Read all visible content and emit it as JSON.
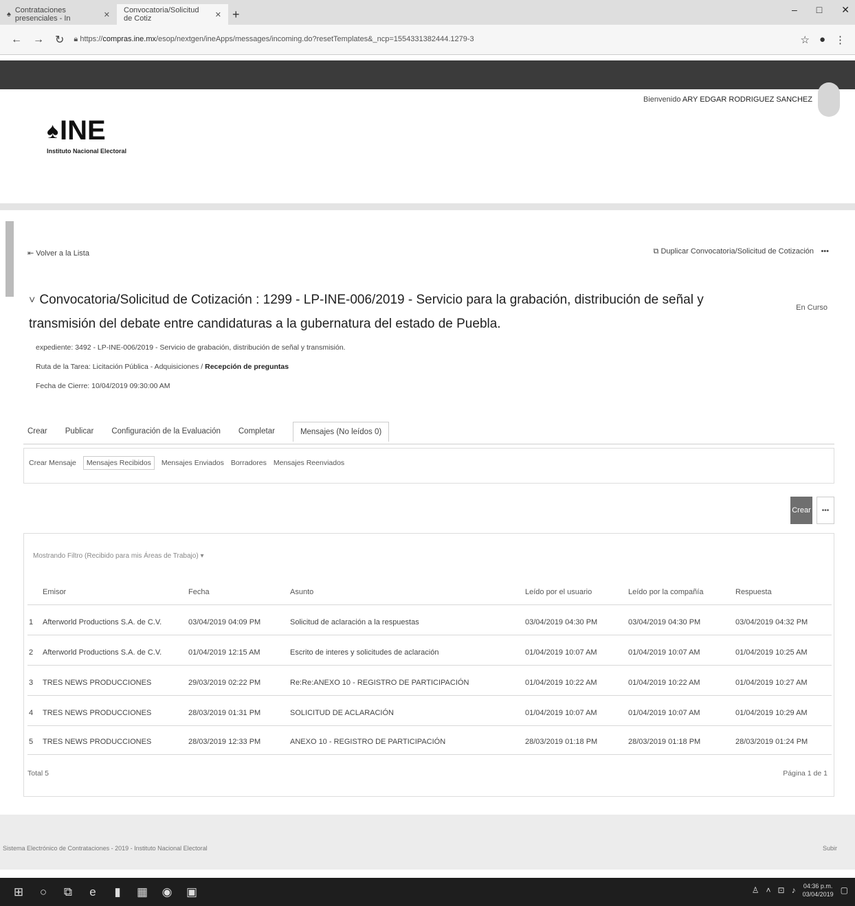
{
  "browser": {
    "tabs": [
      {
        "label": "Contrataciones presenciales - In"
      },
      {
        "label": "Convocatoria/Solicitud de Cotiz"
      }
    ],
    "new_tab": "+",
    "url_prefix": "https://",
    "url_host": "compras.ine.mx",
    "url_path": "/esop/nextgen/ineApps/messages/incoming.do?resetTemplates&_ncp=1554331382444.1279-3"
  },
  "header": {
    "welcome_prefix": "Bienvenido",
    "user_name": "ARY EDGAR RODRIGUEZ SANCHEZ",
    "logo_text": "INE",
    "logo_subtitle": "Instituto Nacional Electoral"
  },
  "page": {
    "back_link": "Volver a la Lista",
    "duplicate_link": "Duplicar Convocatoria/Solicitud de Cotización",
    "more": "•••",
    "title": "Convocatoria/Solicitud de Cotización : 1299 - LP-INE-006/2019 - Servicio para la grabación, distribución de señal y transmisión del debate entre candidaturas a la gubernatura del estado de Puebla.",
    "status": "En Curso",
    "expediente": "expediente: 3492 - LP-INE-006/2019 - Servicio de grabación, distribución de señal y transmisión.",
    "ruta_prefix": "Ruta de la Tarea: Licitación Pública - Adquisiciones /",
    "ruta_bold": "Recepción de preguntas",
    "fecha_cierre": "Fecha de Cierre: 10/04/2019 09:30:00 AM"
  },
  "main_tabs": [
    "Crear",
    "Publicar",
    "Configuración de la Evaluación",
    "Completar",
    "Mensajes (No leídos 0)"
  ],
  "sub_tabs": [
    "Crear Mensaje",
    "Mensajes Recibidos",
    "Mensajes Enviados",
    "Borradores",
    "Mensajes Reenviados"
  ],
  "toolbar": {
    "crear_label": "Crear",
    "more_label": "•••"
  },
  "filter_text": "Mostrando Filtro (Recibido para mis Áreas de Trabajo)",
  "table": {
    "headers": [
      "Emisor",
      "Fecha",
      "Asunto",
      "Leído por el usuario",
      "Leído por la compañía",
      "Respuesta"
    ],
    "rows": [
      {
        "n": "1",
        "emisor": "Afterworld Productions S.A. de C.V.",
        "fecha": "03/04/2019 04:09 PM",
        "asunto": "Solicitud de aclaración a la respuestas",
        "leido_usuario": "03/04/2019 04:30 PM",
        "leido_compania": "03/04/2019 04:30 PM",
        "respuesta": "03/04/2019 04:32 PM"
      },
      {
        "n": "2",
        "emisor": "Afterworld Productions S.A. de C.V.",
        "fecha": "01/04/2019 12:15 AM",
        "asunto": "Escrito de interes y solicitudes de aclaración",
        "leido_usuario": "01/04/2019 10:07 AM",
        "leido_compania": "01/04/2019 10:07 AM",
        "respuesta": "01/04/2019 10:25 AM"
      },
      {
        "n": "3",
        "emisor": "TRES NEWS PRODUCCIONES",
        "fecha": "29/03/2019 02:22 PM",
        "asunto": "Re:Re:ANEXO 10 - REGISTRO DE PARTICIPACIÓN",
        "leido_usuario": "01/04/2019 10:22 AM",
        "leido_compania": "01/04/2019 10:22 AM",
        "respuesta": "01/04/2019 10:27 AM"
      },
      {
        "n": "4",
        "emisor": "TRES NEWS PRODUCCIONES",
        "fecha": "28/03/2019 01:31 PM",
        "asunto": "SOLICITUD DE ACLARACIÓN",
        "leido_usuario": "01/04/2019 10:07 AM",
        "leido_compania": "01/04/2019 10:07 AM",
        "respuesta": "01/04/2019 10:29 AM"
      },
      {
        "n": "5",
        "emisor": "TRES NEWS PRODUCCIONES",
        "fecha": "28/03/2019 12:33 PM",
        "asunto": "ANEXO 10 - REGISTRO DE PARTICIPACIÓN",
        "leido_usuario": "28/03/2019 01:18 PM",
        "leido_compania": "28/03/2019 01:18 PM",
        "respuesta": "28/03/2019 01:24 PM"
      }
    ],
    "total": "Total 5",
    "pagination": "Página 1 de 1"
  },
  "footer": {
    "left": "Sistema Electrónico de Contrataciones - 2019 - Instituto Nacional Electoral",
    "right": "Subir"
  },
  "taskbar": {
    "time": "04:36 p.m.",
    "date": "03/04/2019"
  }
}
